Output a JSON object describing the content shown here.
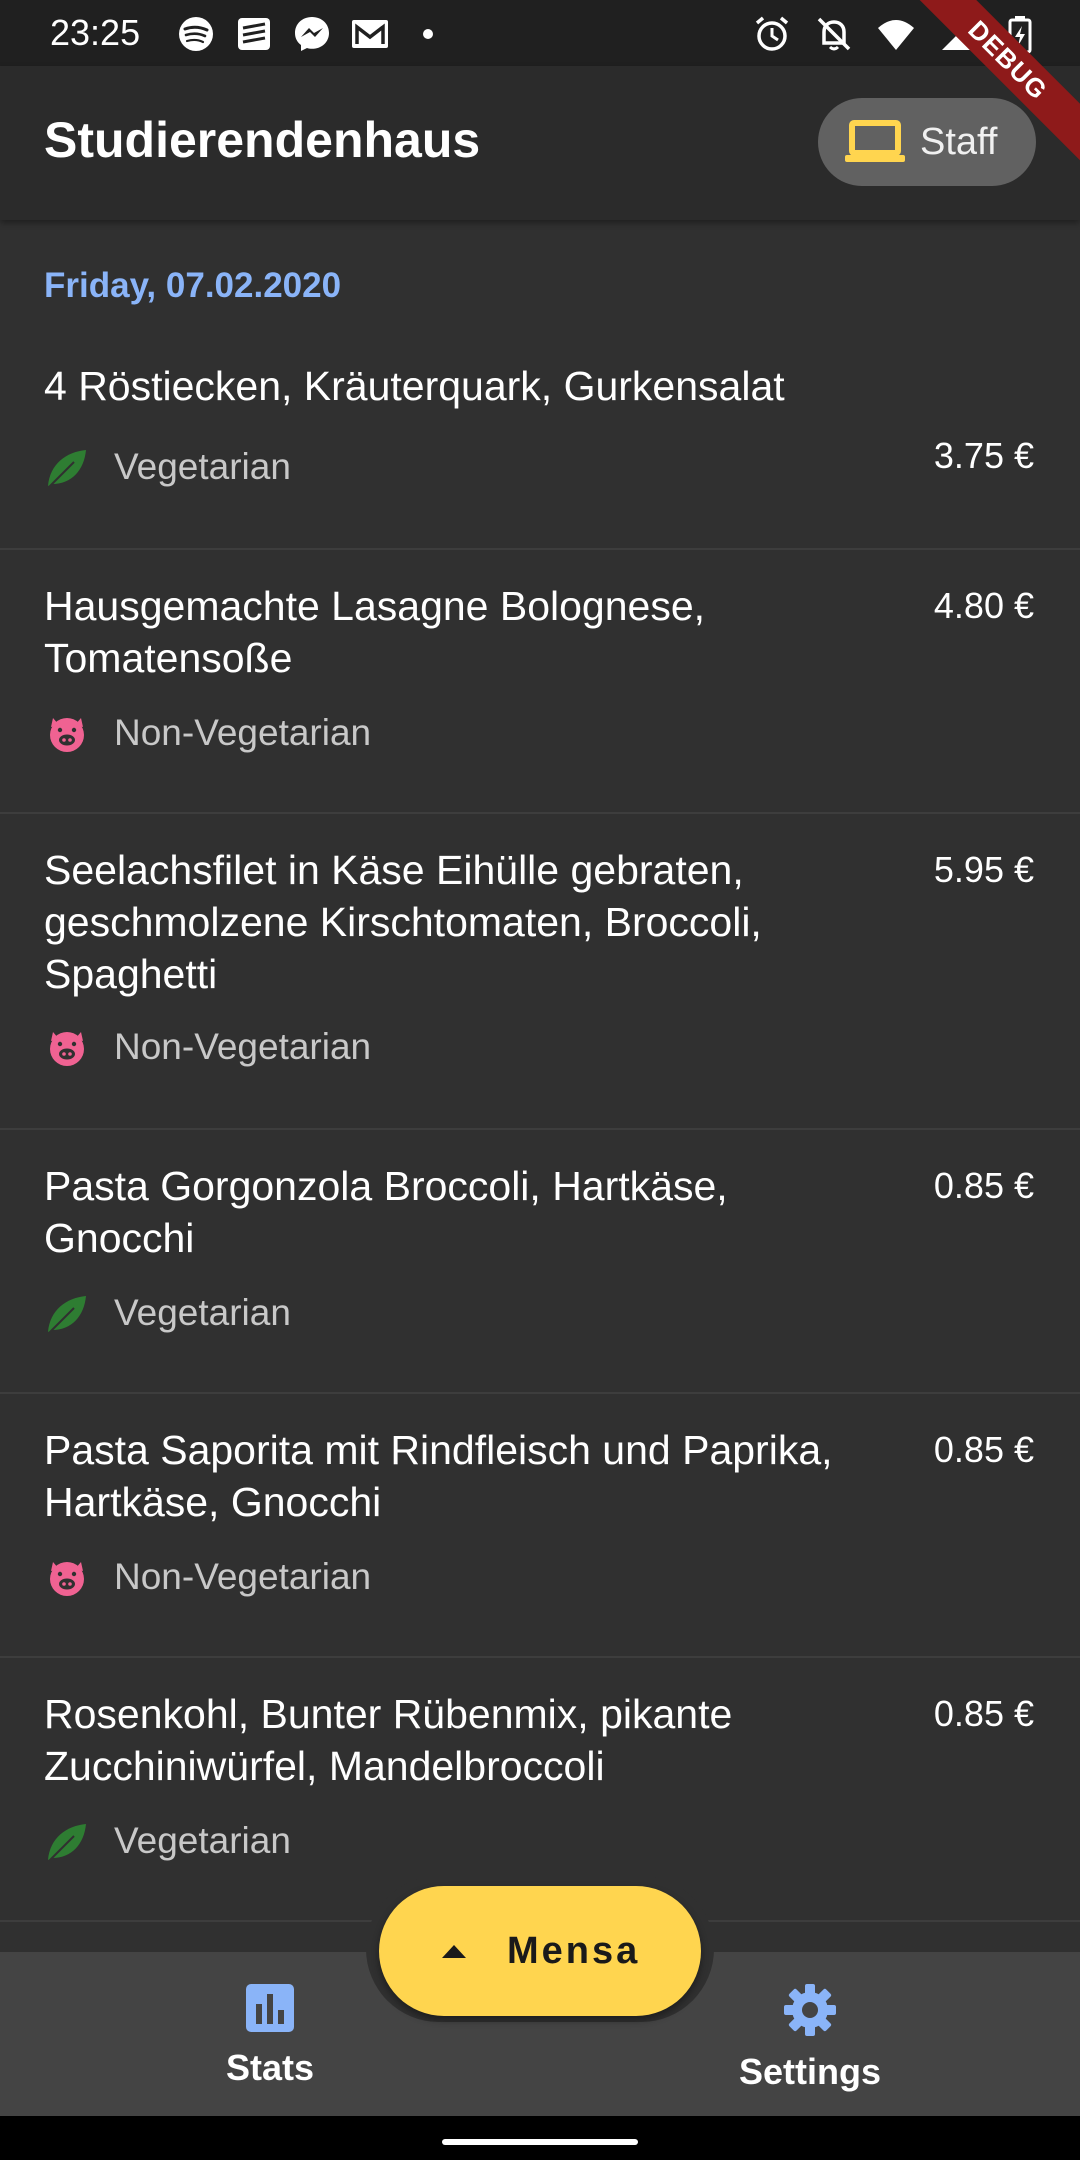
{
  "status_bar": {
    "time": "23:25",
    "left_icons": [
      "spotify-icon",
      "stack-icon",
      "messenger-icon",
      "gmail-icon",
      "dot-icon"
    ],
    "right_icons": [
      "alarm-icon",
      "notifications-off-icon",
      "wifi-icon",
      "signal-icon",
      "battery-charging-icon"
    ]
  },
  "app_bar": {
    "title": "Studierendenhaus",
    "staff_chip": {
      "label": "Staff",
      "icon": "laptop-icon",
      "icon_color": "#ffd54f"
    }
  },
  "debug_banner": "DEBUG",
  "date_header": "Friday, 07.02.2020",
  "meals": [
    {
      "name": "4 Röstiecken, Kräuterquark, Gurkensalat",
      "tag": "Vegetarian",
      "icon": "leaf-icon",
      "price": "3.75 €"
    },
    {
      "name": "Hausgemachte Lasagne Bolognese, Tomatensoße",
      "tag": "Non-Vegetarian",
      "icon": "pig-icon",
      "price": "4.80 €"
    },
    {
      "name": "Seelachsfilet in Käse Eihülle gebraten, geschmolzene Kirschtomaten, Broccoli, Spaghetti",
      "tag": "Non-Vegetarian",
      "icon": "pig-icon",
      "price": "5.95 €"
    },
    {
      "name": "Pasta Gorgonzola Broccoli, Hartkäse, Gnocchi",
      "tag": "Vegetarian",
      "icon": "leaf-icon",
      "price": "0.85 €"
    },
    {
      "name": "Pasta Saporita mit Rindfleisch und Paprika, Hartkäse, Gnocchi",
      "tag": "Non-Vegetarian",
      "icon": "pig-icon",
      "price": "0.85 €"
    },
    {
      "name": "Rosenkohl, Bunter Rübenmix, pikante Zucchiniwürfel, Mandelbroccoli",
      "tag": "Vegetarian",
      "icon": "leaf-icon",
      "price": "0.85 €"
    }
  ],
  "fab": {
    "label": "Mensa",
    "icon": "arrow-up-icon"
  },
  "bottom_nav": {
    "stats_label": "Stats",
    "settings_label": "Settings"
  },
  "colors": {
    "background": "#303030",
    "app_bar": "#2b2b2b",
    "accent_blue": "#8ab4f8",
    "accent_yellow": "#ffd54f",
    "vegetarian_green": "#2e7d32",
    "pig_pink": "#f06292"
  }
}
